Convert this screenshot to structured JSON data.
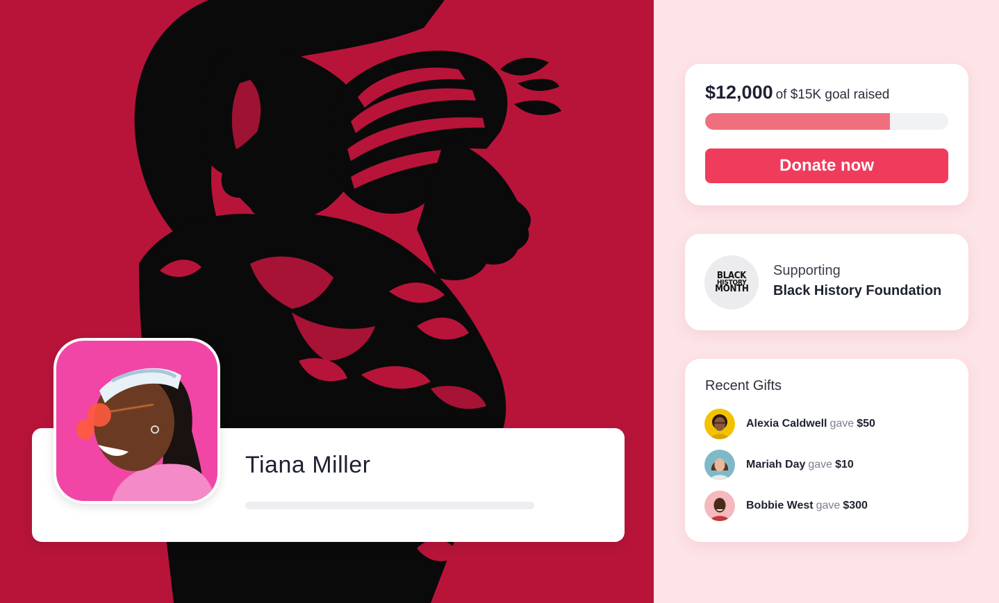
{
  "colors": {
    "hero_bg": "#b8143a",
    "side_bg": "#fde4e7",
    "accent": "#ef3c5c",
    "progress": "#f06f7e"
  },
  "campaign": {
    "raised_amount": "$12,000",
    "goal_text": "of $15K goal raised",
    "progress_fraction": 0.76,
    "donate_label": "Donate now"
  },
  "organization": {
    "logo_lines": [
      "BLACK",
      "HISTORY",
      "MONTH"
    ],
    "supporting_label": "Supporting",
    "name": "Black History Foundation"
  },
  "recent_gifts": {
    "title": "Recent Gifts",
    "items": [
      {
        "name": "Alexia Caldwell",
        "verb": "gave",
        "amount": "$50"
      },
      {
        "name": "Mariah Day",
        "verb": "gave",
        "amount": "$10"
      },
      {
        "name": "Bobbie West",
        "verb": "gave",
        "amount": "$300"
      }
    ]
  },
  "fundraiser": {
    "name": "Tiana Miller"
  }
}
